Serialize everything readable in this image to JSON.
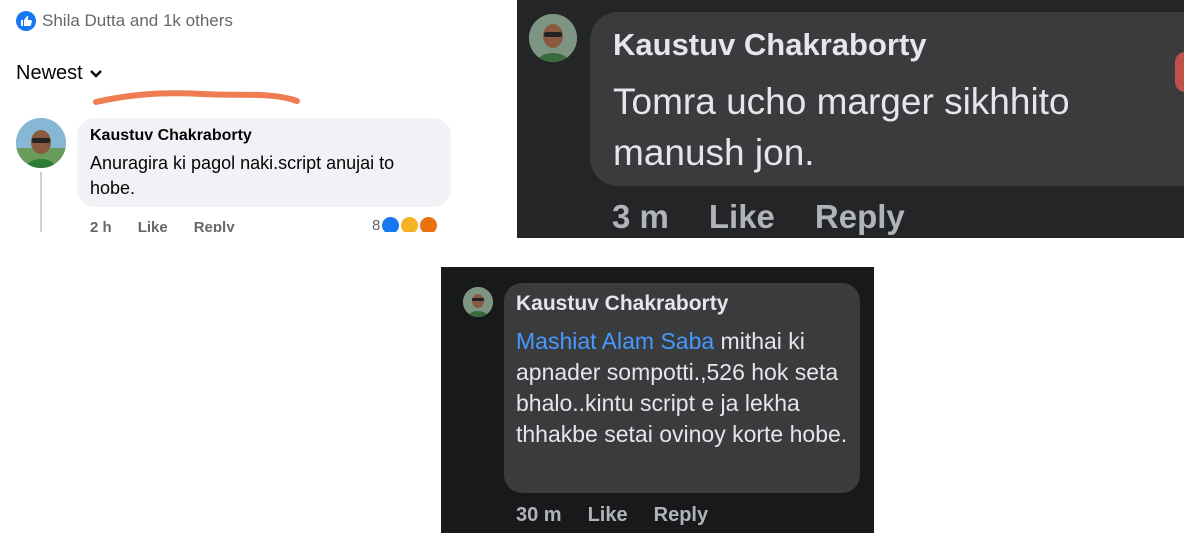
{
  "panel1": {
    "reaction_summary": "Shila Dutta and 1k others",
    "sort_label": "Newest",
    "comment": {
      "author": "Kaustuv Chakraborty",
      "text": "Anuragira ki pagol naki.script anujai to hobe.",
      "time": "2 h",
      "like_label": "Like",
      "reply_label": "Reply",
      "reaction_count": "8"
    },
    "colors": {
      "like_blue": "#1877f2",
      "haha_yellow": "#f7b125",
      "angry_orange": "#e9710f",
      "scribble": "#f07c52"
    }
  },
  "panel2": {
    "comment": {
      "author": "Kaustuv Chakraborty",
      "text": "Tomra ucho marger sikhhito manush jon.",
      "time": "3 m",
      "like_label": "Like",
      "reply_label": "Reply"
    }
  },
  "panel3": {
    "comment": {
      "author": "Kaustuv Chakraborty",
      "mention": "Mashiat Alam Saba",
      "text": " mithai ki apnader sompotti.,526 hok seta bhalo..kintu script e ja lekha thhakbe setai ovinoy korte hobe.",
      "time": "30 m",
      "like_label": "Like",
      "reply_label": "Reply"
    },
    "colors": {
      "mention_blue": "#4599ff"
    }
  }
}
